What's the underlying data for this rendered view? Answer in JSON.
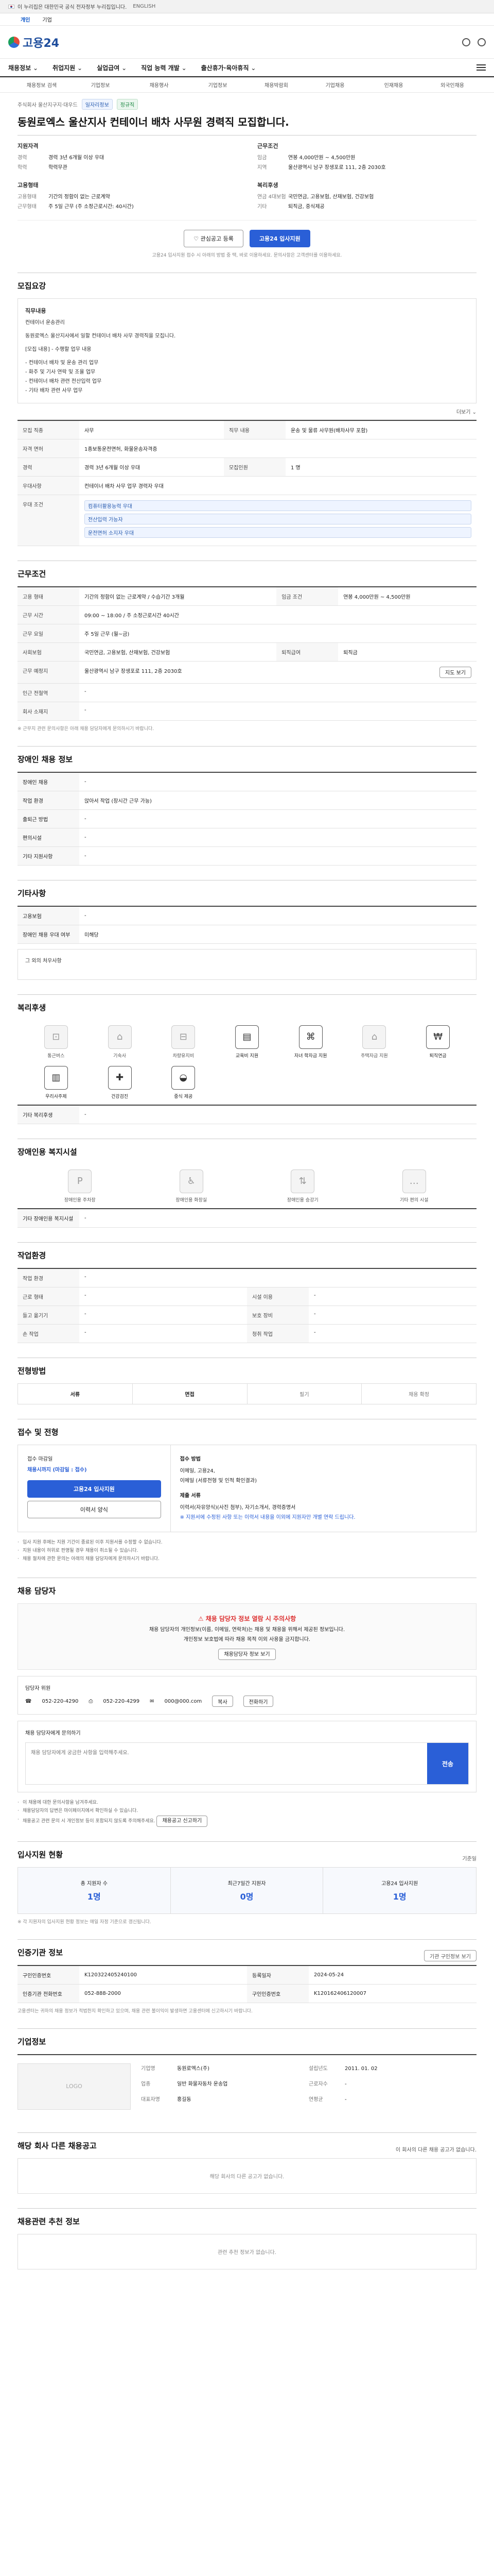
{
  "gov_bar": {
    "notice": "이 누리집은 대한민국 공식 전자정부 누리집입니다.",
    "lang": "ENGLISH"
  },
  "gov_sub": {
    "items": [
      "개인",
      "기업"
    ]
  },
  "brand": {
    "name": "고용24"
  },
  "nav": {
    "items": [
      "채용정보",
      "취업지원",
      "실업급여",
      "직업 능력 개발",
      "출산휴가·육아휴직"
    ]
  },
  "subnav": {
    "items": [
      "채용정보 검색",
      "기업정보",
      "채용행사",
      "기업정보",
      "채용박람회",
      "기업채용",
      "인재채용",
      "외국인채용"
    ]
  },
  "job": {
    "company_line": "주식회사 울산지구지·대우드",
    "badges": [
      "일자리정보",
      "정규직"
    ],
    "title": "동원로엑스 울산지사 컨테이너 배차 사무원 경력직 모집합니다.",
    "summary": {
      "left": [
        {
          "heading": "지원자격",
          "rows": [
            {
              "k": "경력",
              "v": "경력 3년 6개월 이상 우대"
            },
            {
              "k": "학력",
              "v": "학력무관"
            }
          ]
        },
        {
          "heading": "고용형태",
          "rows": [
            {
              "k": "고용형태",
              "v": "기간의 정함이 없는 근로계약"
            },
            {
              "k": "근무형태",
              "v": "주 5일 근무 (주 소정근로시간: 40시간)"
            }
          ]
        }
      ],
      "right": [
        {
          "heading": "근무조건",
          "rows": [
            {
              "k": "임금",
              "v": "연봉 4,000만원 ~ 4,500만원"
            },
            {
              "k": "지역",
              "v": "울산광역시 남구 장생포로 111, 2층 2030호"
            }
          ]
        },
        {
          "heading": "복리후생",
          "rows": [
            {
              "k": "연금 4대보험",
              "v": "국민연금, 고용보험, 산재보험, 건강보험"
            },
            {
              "k": "기타",
              "v": "퇴직금, 중식제공"
            }
          ]
        }
      ]
    },
    "actions": {
      "save": "관심공고 등록",
      "apply": "고용24 입사지원"
    },
    "note": "고용24 입사지원 접수 시 아래의 방법 중 택, 바로 이용하세요. 문의사항은 고객센터를 이용하세요."
  },
  "recruit": {
    "title": "모집요강",
    "desc_heading": "직무내용",
    "desc_lines": [
      "컨테이너 운송관리",
      "",
      "동원로엑스 울산지사에서 일할 컨테이너 배차 사무 경력직을 모집니다.",
      "",
      "[모집 내용] - 수행할 업무 내용",
      "- 컨테이너 배차 및 운송 관리 업무",
      "- 화주 및 기사 연락 및 조율 업무",
      "- 컨테이너 배차 관련 전산입력 업무",
      "- 기타 배차 관련 사무 업무"
    ],
    "more": "더보기 ⌄",
    "rows": [
      {
        "k": "모집 직종",
        "v": "사무"
      },
      {
        "k": "직무 내용",
        "v": "운송 및 물류 사무원(배차사무 포함)"
      },
      {
        "k": "자격 면허",
        "v": "1종보통운전면허, 화물운송자격증"
      },
      {
        "k": "경력",
        "v": "경력 3년 6개월 이상 우대"
      },
      {
        "k": "모집인원",
        "v": "1 명"
      },
      {
        "k": "우대사항",
        "v": "컨테이너 배차 사무 업무 경력자 우대"
      }
    ],
    "tags_heading": "우대 조건",
    "tags": [
      "컴퓨터활용능력 우대",
      "전산입력 가능자",
      "운전면허 소지자 우대"
    ]
  },
  "conditions": {
    "title": "근무조건",
    "rows": [
      {
        "k": "고용 형태",
        "v": "기간의 정함이 없는 근로계약 / 수습기간 3개월"
      },
      {
        "k": "임금 조건",
        "v": "연봉 4,000만원 ~ 4,500만원"
      },
      {
        "k": "근무 시간",
        "v": "09:00 ~ 18:00 / 주 소정근로시간 40시간"
      },
      {
        "k": "근무 요일",
        "v": "주 5일 근무 (월~금)"
      },
      {
        "k": "사회보험",
        "v": "국민연금, 고용보험, 산재보험, 건강보험"
      },
      {
        "k": "퇴직급여",
        "v": "퇴직금"
      },
      {
        "k": "근무 예정지",
        "v": "울산광역시 남구 장생포로 111, 2층 2030호"
      },
      {
        "k": "인근 전철역",
        "v": "-"
      },
      {
        "k": "회사 소재지",
        "v": "-"
      }
    ],
    "map_btn": "지도 보기",
    "footnote": "※ 근무지 관련 문의사항은 아래 채용 담당자에게 문의하시기 바랍니다."
  },
  "disability": {
    "title": "장애인 채용 정보",
    "rows": [
      {
        "k": "장애인 채용",
        "v": "-"
      },
      {
        "k": "작업 환경",
        "v": "앉아서 작업 (장시간 근무 가능)"
      },
      {
        "k": "출퇴근 방법",
        "v": "-"
      },
      {
        "k": "편의시설",
        "v": "-"
      },
      {
        "k": "기타 지원사항",
        "v": "-"
      }
    ]
  },
  "other": {
    "title": "기타사항",
    "rows": [
      {
        "k": "고용보험",
        "v": "-"
      },
      {
        "k": "장애인 채용 우대 여부",
        "v": "미해당"
      }
    ],
    "extra": "그 외의 처우사항"
  },
  "welfare": {
    "title": "복리후생",
    "items": [
      {
        "label": "통근버스",
        "on": false,
        "icon": "bus-icon"
      },
      {
        "label": "기숙사",
        "on": false,
        "icon": "dormitory-icon"
      },
      {
        "label": "차량유지비",
        "on": false,
        "icon": "car-icon"
      },
      {
        "label": "교육비 지원",
        "on": true,
        "icon": "book-icon"
      },
      {
        "label": "자녀 학자금 지원",
        "on": true,
        "icon": "graduation-icon"
      },
      {
        "label": "주택자금 지원",
        "on": false,
        "icon": "house-icon"
      },
      {
        "label": "퇴직연금",
        "on": true,
        "icon": "money-icon"
      },
      {
        "label": "우리사주제",
        "on": true,
        "icon": "stock-icon"
      },
      {
        "label": "건강검진",
        "on": true,
        "icon": "health-icon"
      },
      {
        "label": "중식 제공",
        "on": true,
        "icon": "meal-icon"
      }
    ],
    "extra_k": "기타 복리후생",
    "extra_v": "-"
  },
  "disabled_welfare": {
    "title": "장애인용 복지시설",
    "items": [
      {
        "label": "장애인용 주차장",
        "icon": "parking-icon"
      },
      {
        "label": "장애인용 화장실",
        "icon": "toilet-icon"
      },
      {
        "label": "장애인용 승강기",
        "icon": "elevator-icon"
      },
      {
        "label": "기타 편의 시설",
        "icon": "etc-icon"
      }
    ],
    "extra_k": "기타 장애인용 복지시설",
    "extra_v": "-"
  },
  "env": {
    "title": "작업환경",
    "rows": [
      {
        "k": "작업 환경",
        "v": "-",
        "k2": "",
        "v2": ""
      },
      {
        "k": "근로 형태",
        "v": "-",
        "k2": "시설 이용",
        "v2": "-"
      },
      {
        "k": "들고 옮기기",
        "v": "-",
        "k2": "보호 장비",
        "v2": "-"
      },
      {
        "k": "손 작업",
        "v": "-",
        "k2": "청취 작업",
        "v2": "-"
      }
    ]
  },
  "process": {
    "title": "전형방법",
    "steps": [
      "서류",
      "면접",
      "필기",
      "채용 확정"
    ]
  },
  "apply": {
    "title": "접수 및 전형",
    "left_label": "접수 마감일",
    "deadline": "채용시까지 (마감일 : 접수)",
    "apply_btn": "고용24 입사지원",
    "doc_btn": "이력서 양식",
    "method_label": "접수 방법",
    "methods": [
      "이메일, 고용24,",
      "이메일 (서류전형 및 인적 확인결과)"
    ],
    "docs_label": "제출 서류",
    "docs": [
      "이력서(자유양식)(사진 첨부), 자기소개서, 경력증명서",
      "※ 지원서에 수정된 사항 또는 이력서 내용을 이외에 지원자만 개별 연락 드립니다."
    ],
    "bullets": [
      "입사 지원 후에는 지원 기간이 종료된 이후 지원서를 수정할 수 없습니다.",
      "지원 내용이 허위로 판명될 경우 채용이 취소될 수 있습니다.",
      "채용 절차에 관한 문의는 아래의 채용 담당자에게 문의하시기 바랍니다."
    ]
  },
  "contact": {
    "title": "채용 담당자",
    "warn_title": "채용 담당자 정보 열람 시 주의사항",
    "warn_lines": [
      "채용 담당자의 개인정보(이름, 이메일, 연락처)는 채용 및 채용을 위해서 제공된 정보입니다.",
      "개인정보 보호법에 따라 채용 목적 이외 사용을 금지합니다."
    ],
    "reveal_btn": "채용담당자 정보 보기",
    "name_label": "담당자 위원",
    "phone": "052-220-4290",
    "fax": "052-220-4299",
    "email": "000@000.com",
    "copy_btn": "복사",
    "call_btn": "전화하기",
    "inquiry_title": "채용 담당자에게 문의하기",
    "inquiry_placeholder": "채용 담당자에게 궁금한 사항을 입력해주세요.",
    "send": "전송",
    "inquiry_bullets": [
      "이 채용에 대한 문의사항을 남겨주세요.",
      "채용담당자의 답변은 마이페이지에서 확인하실 수 있습니다.",
      "채용공고 관련 문의 시 개인정보 등이 포함되지 않도록 주의해주세요."
    ],
    "report_btn": "채용공고 신고하기"
  },
  "stats": {
    "title": "입사지원 현황",
    "refresh": "기준일",
    "items": [
      {
        "label": "총 지원자 수",
        "value": "1명"
      },
      {
        "label": "최근7일간 지원자",
        "value": "0명"
      },
      {
        "label": "고용24 입사지원",
        "value": "1명"
      }
    ],
    "note": "※ 각 지원자의 입사지원 현황 정보는 매일 자정 기준으로 갱신됩니다."
  },
  "auth": {
    "title": "인증기관 정보",
    "btn": "기관 구인정보 보기",
    "rows": [
      {
        "k": "구인인증번호",
        "v": "K120322405240100",
        "k2": "등록일자",
        "v2": "2024-05-24"
      },
      {
        "k": "인증기관 전화번호",
        "v": "052-888-2000",
        "k2": "구인인증번호",
        "v2": "K120162406120007"
      }
    ],
    "note": "고용센터는 귀하의 채용 정보가 적법한지 확인하고 있으며, 채용 관련 불이익이 발생하면 고용센터에 신고하시기 바랍니다."
  },
  "company": {
    "title": "기업정보",
    "logo": "LOGO",
    "rows": [
      {
        "k": "기업명",
        "v": "동원로엑스(주)"
      },
      {
        "k": "업종",
        "v": "일반 화물자동차 운송업"
      },
      {
        "k": "설립년도",
        "v": "2011. 01. 02"
      },
      {
        "k": "근로자수",
        "v": "-"
      },
      {
        "k": "대표자명",
        "v": "홍길동"
      },
      {
        "k": "연평균",
        "v": "-"
      }
    ]
  },
  "other_jobs": {
    "title": "해당 회사 다른 채용공고",
    "right": "이 회사의 다른 채용 공고가 없습니다.",
    "empty": "해당 회사의 다른 공고가 없습니다."
  },
  "recommend": {
    "title": "채용관련 추천 정보",
    "empty": "관련 추천 정보가 없습니다."
  }
}
